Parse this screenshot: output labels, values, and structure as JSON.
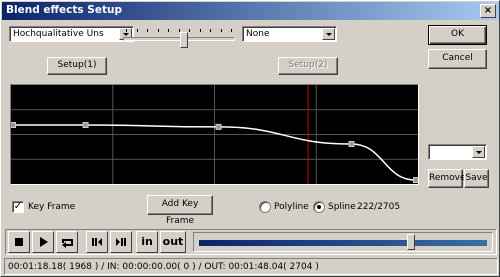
{
  "window": {
    "title": "Blend effects Setup",
    "close_label": "×"
  },
  "quality_select": {
    "value": "Hochqualitative Uns"
  },
  "effect_select": {
    "value": "None"
  },
  "buttons": {
    "ok": "OK",
    "cancel": "Cancel",
    "setup1": "Setup(1)",
    "setup2": "Setup(2)",
    "add_key_frame": "Add Key Frame",
    "remove": "Remove",
    "save": "Save"
  },
  "preset_select": {
    "value": ""
  },
  "key_frame": {
    "label": "Key Frame",
    "checked": true
  },
  "interpolation": {
    "polyline_label": "Polyline",
    "spline_label": "Spline",
    "selected": "Spline",
    "position_readout": "222/2705"
  },
  "blend_slider": {
    "level": 0.55
  },
  "graph": {
    "keyframes": [
      [
        0.0,
        0.6
      ],
      [
        0.18,
        0.6
      ],
      [
        0.51,
        0.58
      ],
      [
        0.84,
        0.4
      ],
      [
        1.0,
        0.02
      ]
    ],
    "cursor": 0.73
  },
  "transport": {
    "stop_icon": "stop-icon",
    "play_icon": "play-icon",
    "loop_icon": "loop-icon",
    "prev_icon": "prev-frame-icon",
    "next_icon": "next-frame-icon",
    "in_label": "in",
    "out_label": "out",
    "position": 0.73
  },
  "status": {
    "text": "00:01:18.18( 1968 ) / IN: 00:00:00.00( 0 ) / OUT: 00:01:48.04( 2704 )"
  },
  "colors": {
    "title_start": "#0a246a",
    "title_end": "#a6caf0",
    "curve": "#ffffff",
    "cursor_line": "#c00000"
  }
}
